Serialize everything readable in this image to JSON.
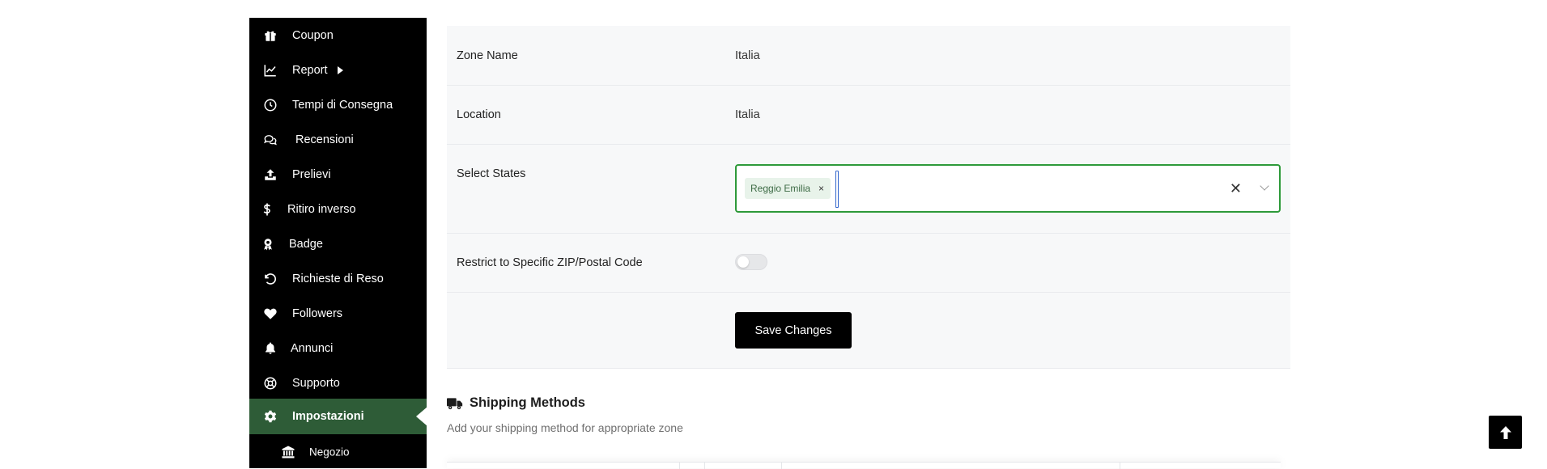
{
  "sidebar": {
    "items": [
      {
        "label": "Coupon",
        "icon": "gift-icon"
      },
      {
        "label": "Report",
        "icon": "chart-line-icon",
        "has_submenu": true
      },
      {
        "label": "Tempi di Consegna",
        "icon": "clock-icon"
      },
      {
        "label": "Recensioni",
        "icon": "comments-icon"
      },
      {
        "label": "Prelievi",
        "icon": "upload-icon"
      },
      {
        "label": "Ritiro inverso",
        "icon": "dollar-icon"
      },
      {
        "label": "Badge",
        "icon": "award-icon"
      },
      {
        "label": "Richieste di Reso",
        "icon": "undo-icon"
      },
      {
        "label": "Followers",
        "icon": "heart-icon"
      },
      {
        "label": "Annunci",
        "icon": "bell-icon"
      },
      {
        "label": "Supporto",
        "icon": "lifebuoy-icon"
      },
      {
        "label": "Impostazioni",
        "icon": "gear-icon",
        "active": true
      },
      {
        "label": "Negozio",
        "icon": "bank-icon",
        "sub": true
      }
    ]
  },
  "form": {
    "zone_name_label": "Zone Name",
    "zone_name_value": "Italia",
    "location_label": "Location",
    "location_value": "Italia",
    "select_states_label": "Select States",
    "selected_states": [
      "Reggio Emilia"
    ],
    "tag_remove": "×",
    "clear_all": "✕",
    "restrict_label": "Restrict to Specific ZIP/Postal Code",
    "restrict_enabled": false,
    "save_label": "Save Changes"
  },
  "shipping": {
    "title": "Shipping Methods",
    "subtitle": "Add your shipping method for appropriate zone"
  },
  "colors": {
    "sidebar_bg": "#000000",
    "active_item_bg": "#2e5c37",
    "select_border": "#2e9a3a",
    "button_bg": "#000000"
  }
}
